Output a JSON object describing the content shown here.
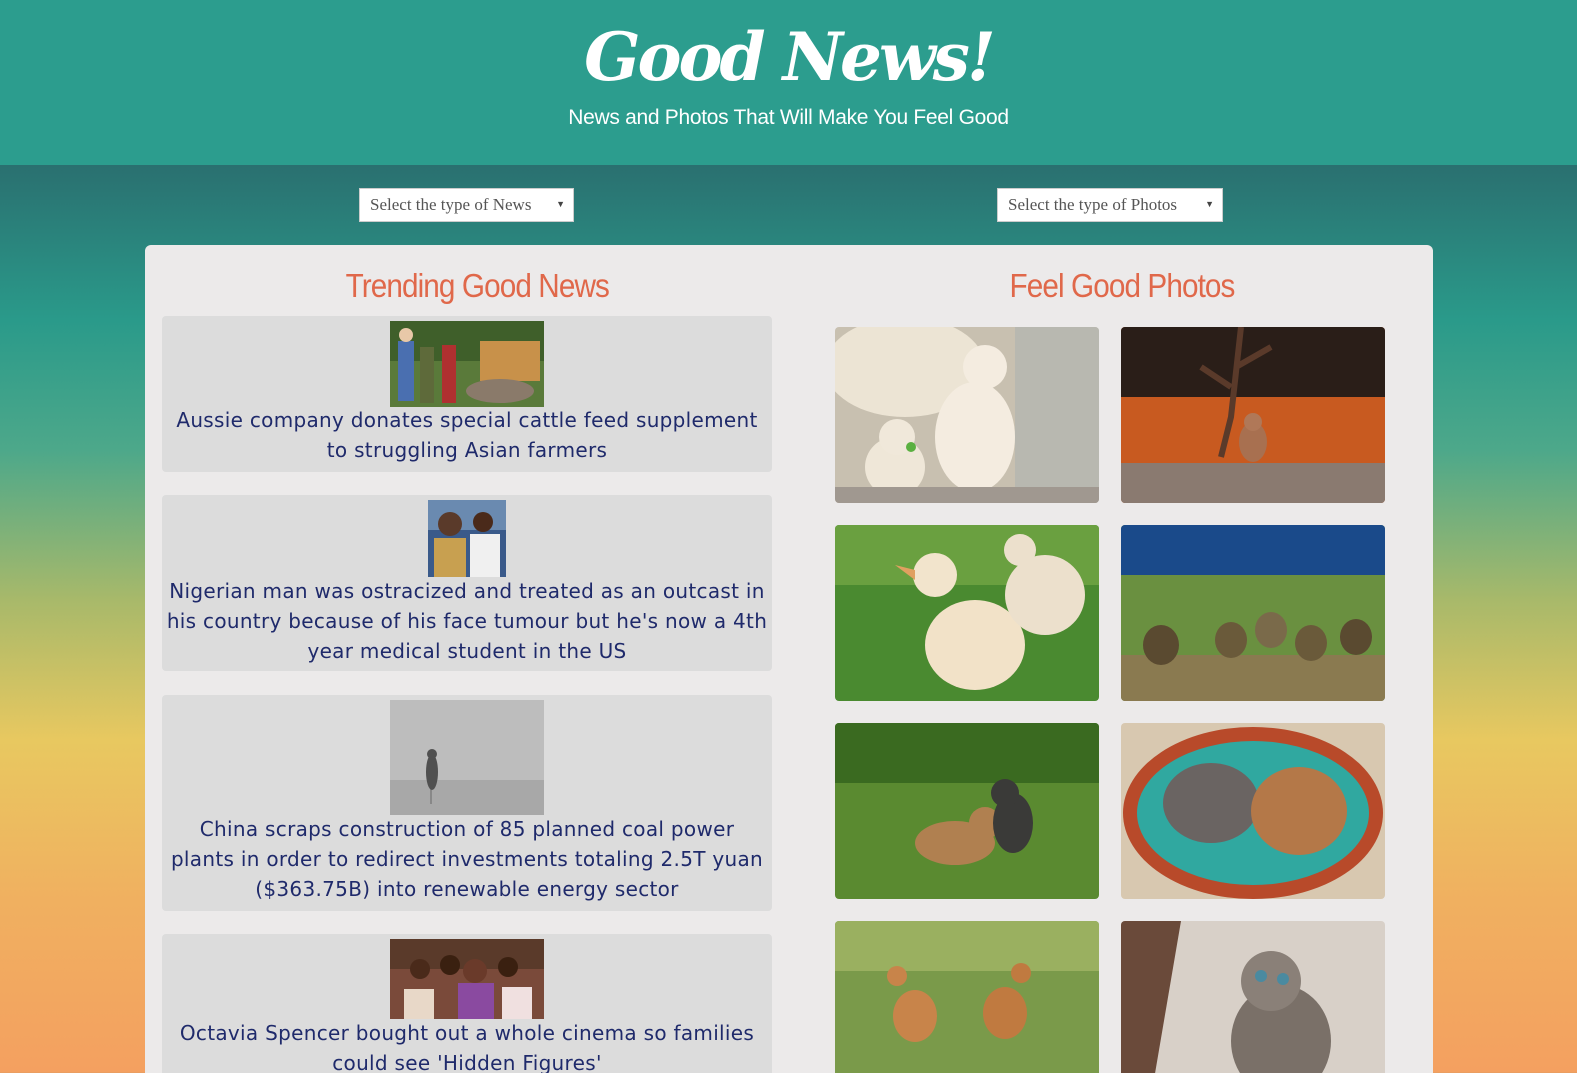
{
  "header": {
    "logo": "Good News!",
    "tagline": "News and Photos That Will Make You Feel Good"
  },
  "controls": {
    "news_select": "Select the type of News",
    "photos_select": "Select the type of Photos"
  },
  "news": {
    "title": "Trending Good News",
    "items": [
      {
        "headline": "Aussie company donates special cattle feed supplement to struggling Asian farmers",
        "thumb_icon": "cattle-photo"
      },
      {
        "headline": "Nigerian man was ostracized and treated as an outcast in his country because of his face tumour but he's now a 4th year medical student in the US",
        "thumb_icon": "student-photo"
      },
      {
        "headline": "China scraps construction of 85 planned coal power plants in order to redirect investments totaling 2.5T yuan ($363.75B) into renewable energy sector",
        "thumb_icon": "smog-photo"
      },
      {
        "headline": "Octavia Spencer bought out a whole cinema so families could see 'Hidden Figures'",
        "thumb_icon": "cinema-photo"
      }
    ]
  },
  "photos": {
    "title": "Feel Good Photos",
    "items": [
      "polar-bear-cubs",
      "squirrel",
      "ducklings",
      "goslings",
      "puppies",
      "cats-in-basket",
      "crane-chicks",
      "kitten"
    ]
  }
}
